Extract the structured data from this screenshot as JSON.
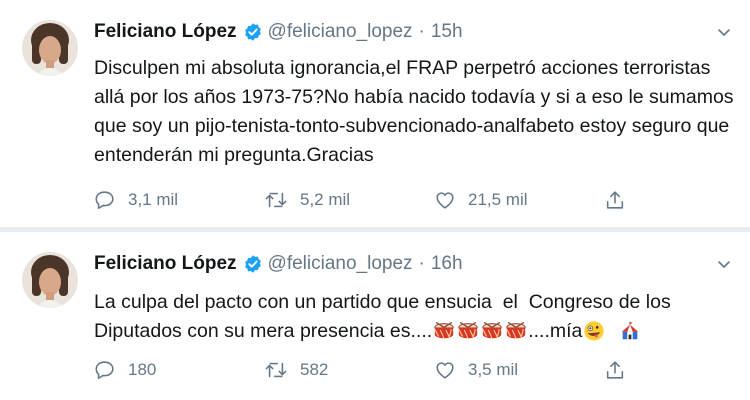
{
  "tweets": [
    {
      "author_name": "Feliciano López",
      "handle": "@feliciano_lopez",
      "separator": "·",
      "time": "15h",
      "text": "Disculpen mi absoluta ignorancia,el FRAP perpetró acciones terroristas allá por los años 1973-75?No había nacido todavía y si a eso le sumamos que soy un pijo-tenista-tonto-subvencionado-analfabeto estoy seguro que entenderán mi pregunta.Gracias",
      "replies": "3,1 mil",
      "retweets": "5,2 mil",
      "likes": "21,5 mil"
    },
    {
      "author_name": "Feliciano López",
      "handle": "@feliciano_lopez",
      "separator": "·",
      "time": "16h",
      "text_before": "La culpa del pacto con un partido que ensucia  el  Congreso de los Diputados con su mera presencia es....",
      "text_middle": "....mía",
      "replies": "180",
      "retweets": "582",
      "likes": "3,5 mil"
    }
  ],
  "icons": {
    "verified": "verified-badge-icon",
    "caret": "chevron-down-icon",
    "reply": "reply-bubble-icon",
    "retweet": "retweet-icon",
    "like": "heart-icon",
    "share": "share-upload-icon",
    "drum": "drum-emoji-icon",
    "crazy_face": "zany-face-emoji-icon",
    "circus": "circus-tent-emoji-icon"
  },
  "colors": {
    "verified_blue": "#1da1f2",
    "text": "#14171a",
    "muted": "#657786",
    "separator": "#e6ecf0"
  }
}
